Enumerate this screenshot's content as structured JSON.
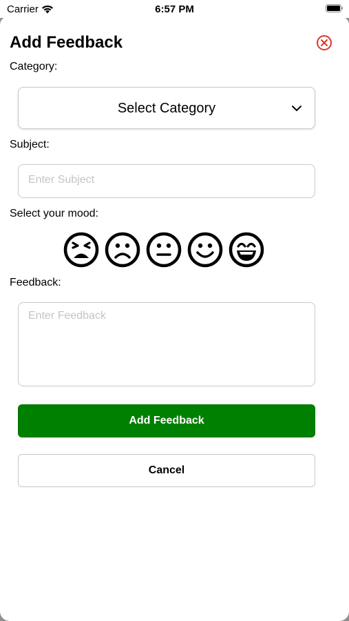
{
  "status_bar": {
    "carrier": "Carrier",
    "time": "6:57 PM"
  },
  "modal": {
    "title": "Add Feedback",
    "category_label": "Category:",
    "category_select": {
      "selected": "Select Category"
    },
    "subject_label": "Subject:",
    "subject_input": {
      "value": "",
      "placeholder": "Enter Subject"
    },
    "mood_label": "Select your mood:",
    "moods": [
      "very-sad",
      "sad",
      "neutral",
      "happy",
      "very-happy"
    ],
    "feedback_label": "Feedback:",
    "feedback_input": {
      "value": "",
      "placeholder": "Enter Feedback"
    },
    "add_button": "Add Feedback",
    "cancel_button": "Cancel"
  },
  "colors": {
    "accent_green": "#008000",
    "close_red": "#e0312b",
    "placeholder": "#c4c4c8",
    "border": "#c8c8cc"
  }
}
